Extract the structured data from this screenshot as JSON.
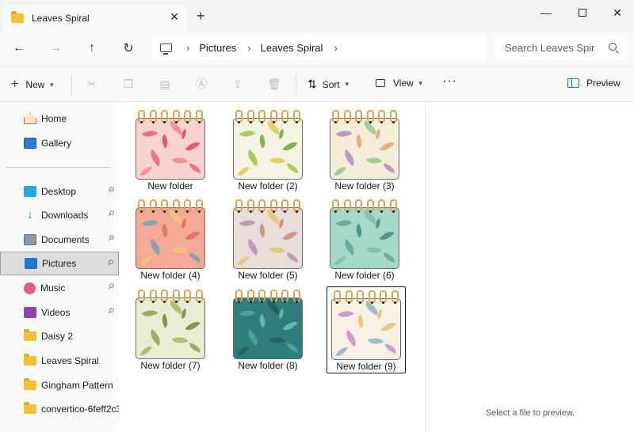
{
  "window": {
    "tab_title": "Leaves Spiral",
    "new_tab_symbol": "+",
    "tab_close_symbol": "✕",
    "minimize_symbol": "—",
    "close_symbol": "✕"
  },
  "nav": {
    "back_symbol": "←",
    "forward_symbol": "→",
    "up_symbol": "↑",
    "refresh_symbol": "↻",
    "breadcrumbs": [
      "Pictures",
      "Leaves Spiral"
    ],
    "separator": "›",
    "search_placeholder": "Search Leaves Spir"
  },
  "commandbar": {
    "new_label": "New",
    "sort_label": "Sort",
    "view_label": "View",
    "more_symbol": "···",
    "preview_label": "Preview",
    "icons": [
      "cut-icon",
      "copy-icon",
      "paste-icon",
      "rename-icon",
      "share-icon",
      "delete-icon"
    ]
  },
  "sidebar": {
    "items": [
      {
        "label": "Home",
        "icon": "home-icon",
        "pinned": false
      },
      {
        "label": "Gallery",
        "icon": "gallery-icon",
        "pinned": false
      },
      {
        "label": "Desktop",
        "icon": "desktop-icon",
        "pinned": true
      },
      {
        "label": "Downloads",
        "icon": "downloads-icon",
        "pinned": true
      },
      {
        "label": "Documents",
        "icon": "documents-icon",
        "pinned": true
      },
      {
        "label": "Pictures",
        "icon": "pictures-icon",
        "pinned": true,
        "selected": true
      },
      {
        "label": "Music",
        "icon": "music-icon",
        "pinned": true
      },
      {
        "label": "Videos",
        "icon": "videos-icon",
        "pinned": true
      },
      {
        "label": "Daisy 2",
        "icon": "folder-icon",
        "pinned": false
      },
      {
        "label": "Leaves Spiral",
        "icon": "folder-icon",
        "pinned": false
      },
      {
        "label": "Gingham Pattern",
        "icon": "folder-icon",
        "pinned": false
      },
      {
        "label": "convertico-6feff2c3",
        "icon": "folder-icon",
        "pinned": false
      }
    ]
  },
  "folders": [
    {
      "label": "New folder",
      "bg": "#f7d3cf",
      "leaf1": "#e8607a",
      "leaf2": "#f08a8a",
      "leaf3": "#d4466a"
    },
    {
      "label": "New folder (2)",
      "bg": "#f4f2e2",
      "leaf1": "#9cc43e",
      "leaf2": "#e3c955",
      "leaf3": "#6ea537"
    },
    {
      "label": "New folder (3)",
      "bg": "#f3ecd8",
      "leaf1": "#b08bc4",
      "leaf2": "#9cc48a",
      "leaf3": "#e2a477"
    },
    {
      "label": "New folder (4)",
      "bg": "#f4a896",
      "leaf1": "#6ea5b5",
      "leaf2": "#f2c779",
      "leaf3": "#e06e5a"
    },
    {
      "label": "New folder (5)",
      "bg": "#e8ddd8",
      "leaf1": "#b58fb5",
      "leaf2": "#e2c86e",
      "leaf3": "#d18a7c"
    },
    {
      "label": "New folder (6)",
      "bg": "#a5d8c8",
      "leaf1": "#5fa590",
      "leaf2": "#7ec0ad",
      "leaf3": "#3e8c78"
    },
    {
      "label": "New folder (7)",
      "bg": "#e9ecd2",
      "leaf1": "#8aa34e",
      "leaf2": "#a5b866",
      "leaf3": "#6c8a38"
    },
    {
      "label": "New folder (8)",
      "bg": "#2e7d7a",
      "leaf1": "#4ea7a0",
      "leaf2": "#1f5e5b",
      "leaf3": "#6cc0b8"
    },
    {
      "label": "New folder (9)",
      "bg": "#f6f1e4",
      "leaf1": "#c68fbf",
      "leaf2": "#8bb5c9",
      "leaf3": "#e3c46d",
      "selected": true
    }
  ],
  "preview": {
    "message": "Select a file to preview."
  },
  "pin_symbol": "📌"
}
